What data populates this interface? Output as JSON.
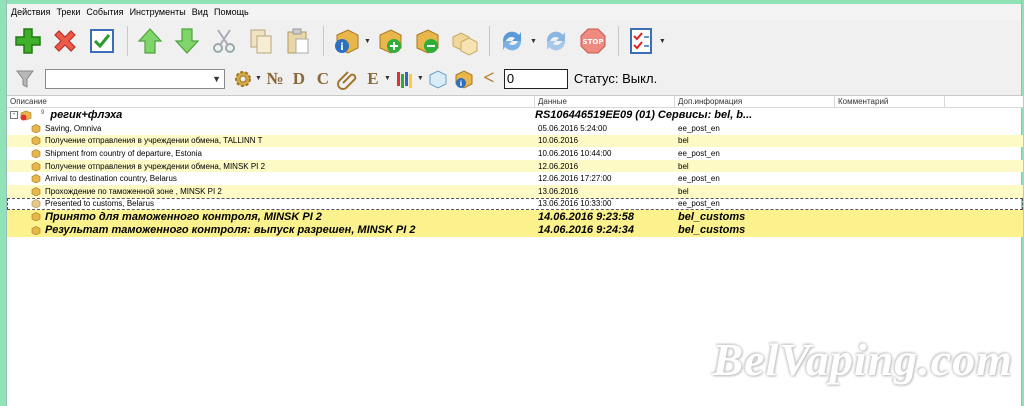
{
  "menu": [
    "Действия",
    "Треки",
    "События",
    "Инструменты",
    "Вид",
    "Помощь"
  ],
  "columns": [
    "Описание",
    "Данные",
    "Доп.информация",
    "Комментарий"
  ],
  "toolbar2": {
    "combo_value": "",
    "letters": [
      "№",
      "D",
      "C",
      "E"
    ],
    "less_than": "<",
    "number_value": "0",
    "status_text": "Статус: Выкл."
  },
  "parent": {
    "expander": "-",
    "count": "9",
    "description": "регик+флэха",
    "data": "RS106446519EE",
    "info": "09 (01) Сервисы: bel, b..."
  },
  "rows": [
    {
      "desc": "Saving, Omniva",
      "data": "05.06.2016 5:24:00",
      "info": "ee_post_en"
    },
    {
      "desc": "Получение отправления в учреждении обмена, TALLINN T",
      "data": "10.06.2016",
      "info": "bel"
    },
    {
      "desc": "Shipment from country of departure, Estonia",
      "data": "10.06.2016 10:44:00",
      "info": "ee_post_en"
    },
    {
      "desc": "Получение отправления в учреждении обмена, MINSK PI 2",
      "data": "12.06.2016",
      "info": "bel"
    },
    {
      "desc": "Arrival to destination country, Belarus",
      "data": "12.06.2016 17:27:00",
      "info": "ee_post_en"
    },
    {
      "desc": "Прохождение по таможенной зоне , MINSK PI 2",
      "data": "13.06.2016",
      "info": "bel"
    },
    {
      "desc": "Presented to customs, Belarus",
      "data": "13.06.2016 10:33:00",
      "info": "ee_post_en"
    },
    {
      "desc": "Принято для таможенного контроля, MINSK PI 2",
      "data": "14.06.2016 9:23:58",
      "info": "bel_customs"
    },
    {
      "desc": "Результат таможенного контроля: выпуск разрешен, MINSK PI 2",
      "data": "14.06.2016 9:24:34",
      "info": "bel_customs"
    }
  ],
  "watermark": "BelVaping.com",
  "icons": [
    "add-icon",
    "delete-icon",
    "check-icon",
    "arrow-up-icon",
    "arrow-down-icon",
    "cut-icon",
    "copy-icon",
    "paste-icon",
    "info-package-icon",
    "add-package-icon",
    "remove-package-icon",
    "packages-icon",
    "refresh-icon",
    "refresh-all-icon",
    "stop-icon",
    "checklist-icon",
    "filter-icon",
    "gear-icon",
    "paperclip-icon",
    "flags-icon",
    "box-icon",
    "info-box-icon"
  ]
}
